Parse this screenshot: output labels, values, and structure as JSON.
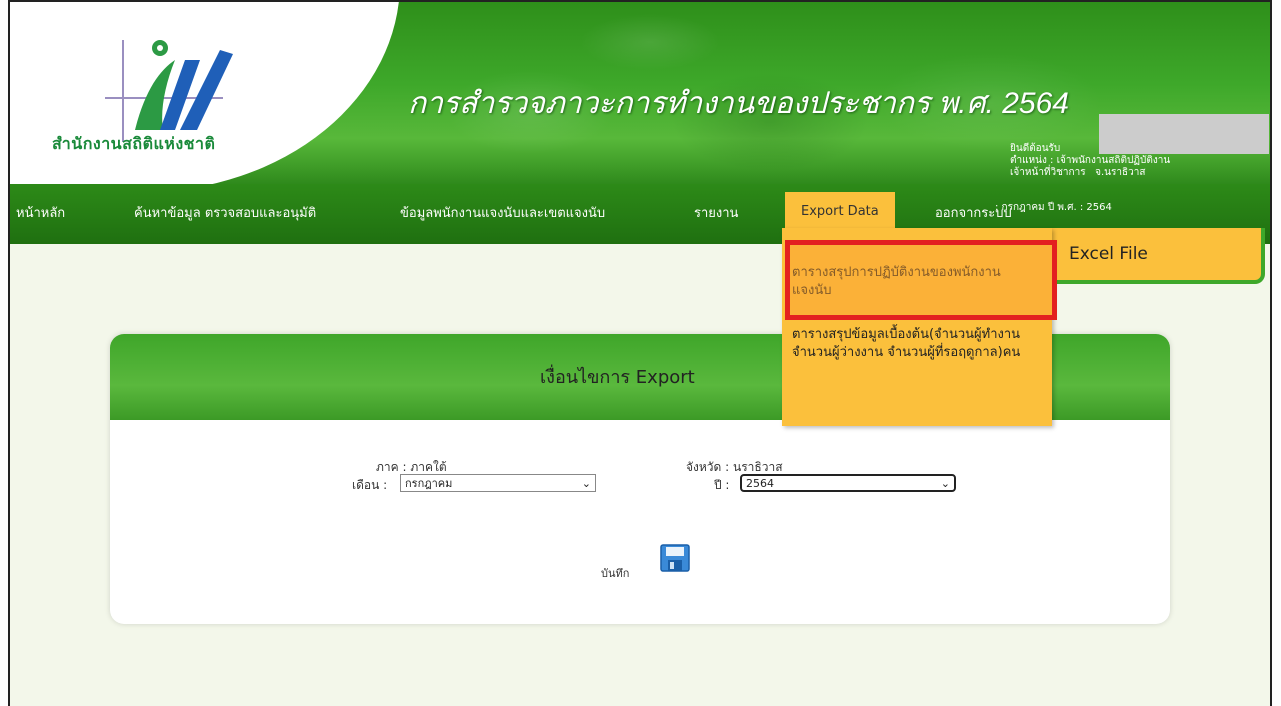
{
  "header": {
    "org_name": "สำนักงานสถิติแห่งชาติ",
    "site_title": "การสำรวจภาวะการทำงานของประชากร พ.ศ. 2564",
    "welcome": "ยินดีต้อนรับ",
    "position": "ตำแหน่ง : เจ้าพนักงานสถิติปฏิบัติงาน",
    "officer": "เจ้าหน้าที่วิชาการ",
    "province_short": "จ.นราธิวาส",
    "month_year": ": กรกฎาคม  ปี พ.ศ. : 2564"
  },
  "nav": {
    "items": [
      "หน้าหลัก",
      "ค้นหาข้อมูล ตรวจสอบและอนุมัติ",
      "ข้อมูลพนักงานแจงนับและเขตแจงนับ",
      "รายงาน",
      "Export Data",
      "ออกจากระบบ"
    ],
    "active_index": 4
  },
  "excel_tab": {
    "label": "Excel File"
  },
  "dropdown": {
    "items": [
      "ตารางสรุปการปฏิบัติงานของพนักงานแจงนับ",
      "ตารางสรุปข้อมูลเบื้องต้น(จำนวนผู้ทำงาน จำนวนผู้ว่างงาน จำนวนผู้ที่รอฤดูกาล)คน"
    ],
    "highlighted_index": 0
  },
  "panel": {
    "title": "เงื่อนไขการ Export",
    "region_label": "ภาค : ภาคใต้",
    "province_label": "จังหวัด : นราธิวาส",
    "month_label": "เดือน :",
    "month_value": "กรกฎาคม",
    "year_label": "ปี :",
    "year_value": "2564",
    "save_label": "บันทึก"
  },
  "colors": {
    "green": "#3ea82a",
    "nav_green": "#1f7010",
    "menu_yellow": "#fbc03c",
    "highlight_red": "#e32020"
  }
}
